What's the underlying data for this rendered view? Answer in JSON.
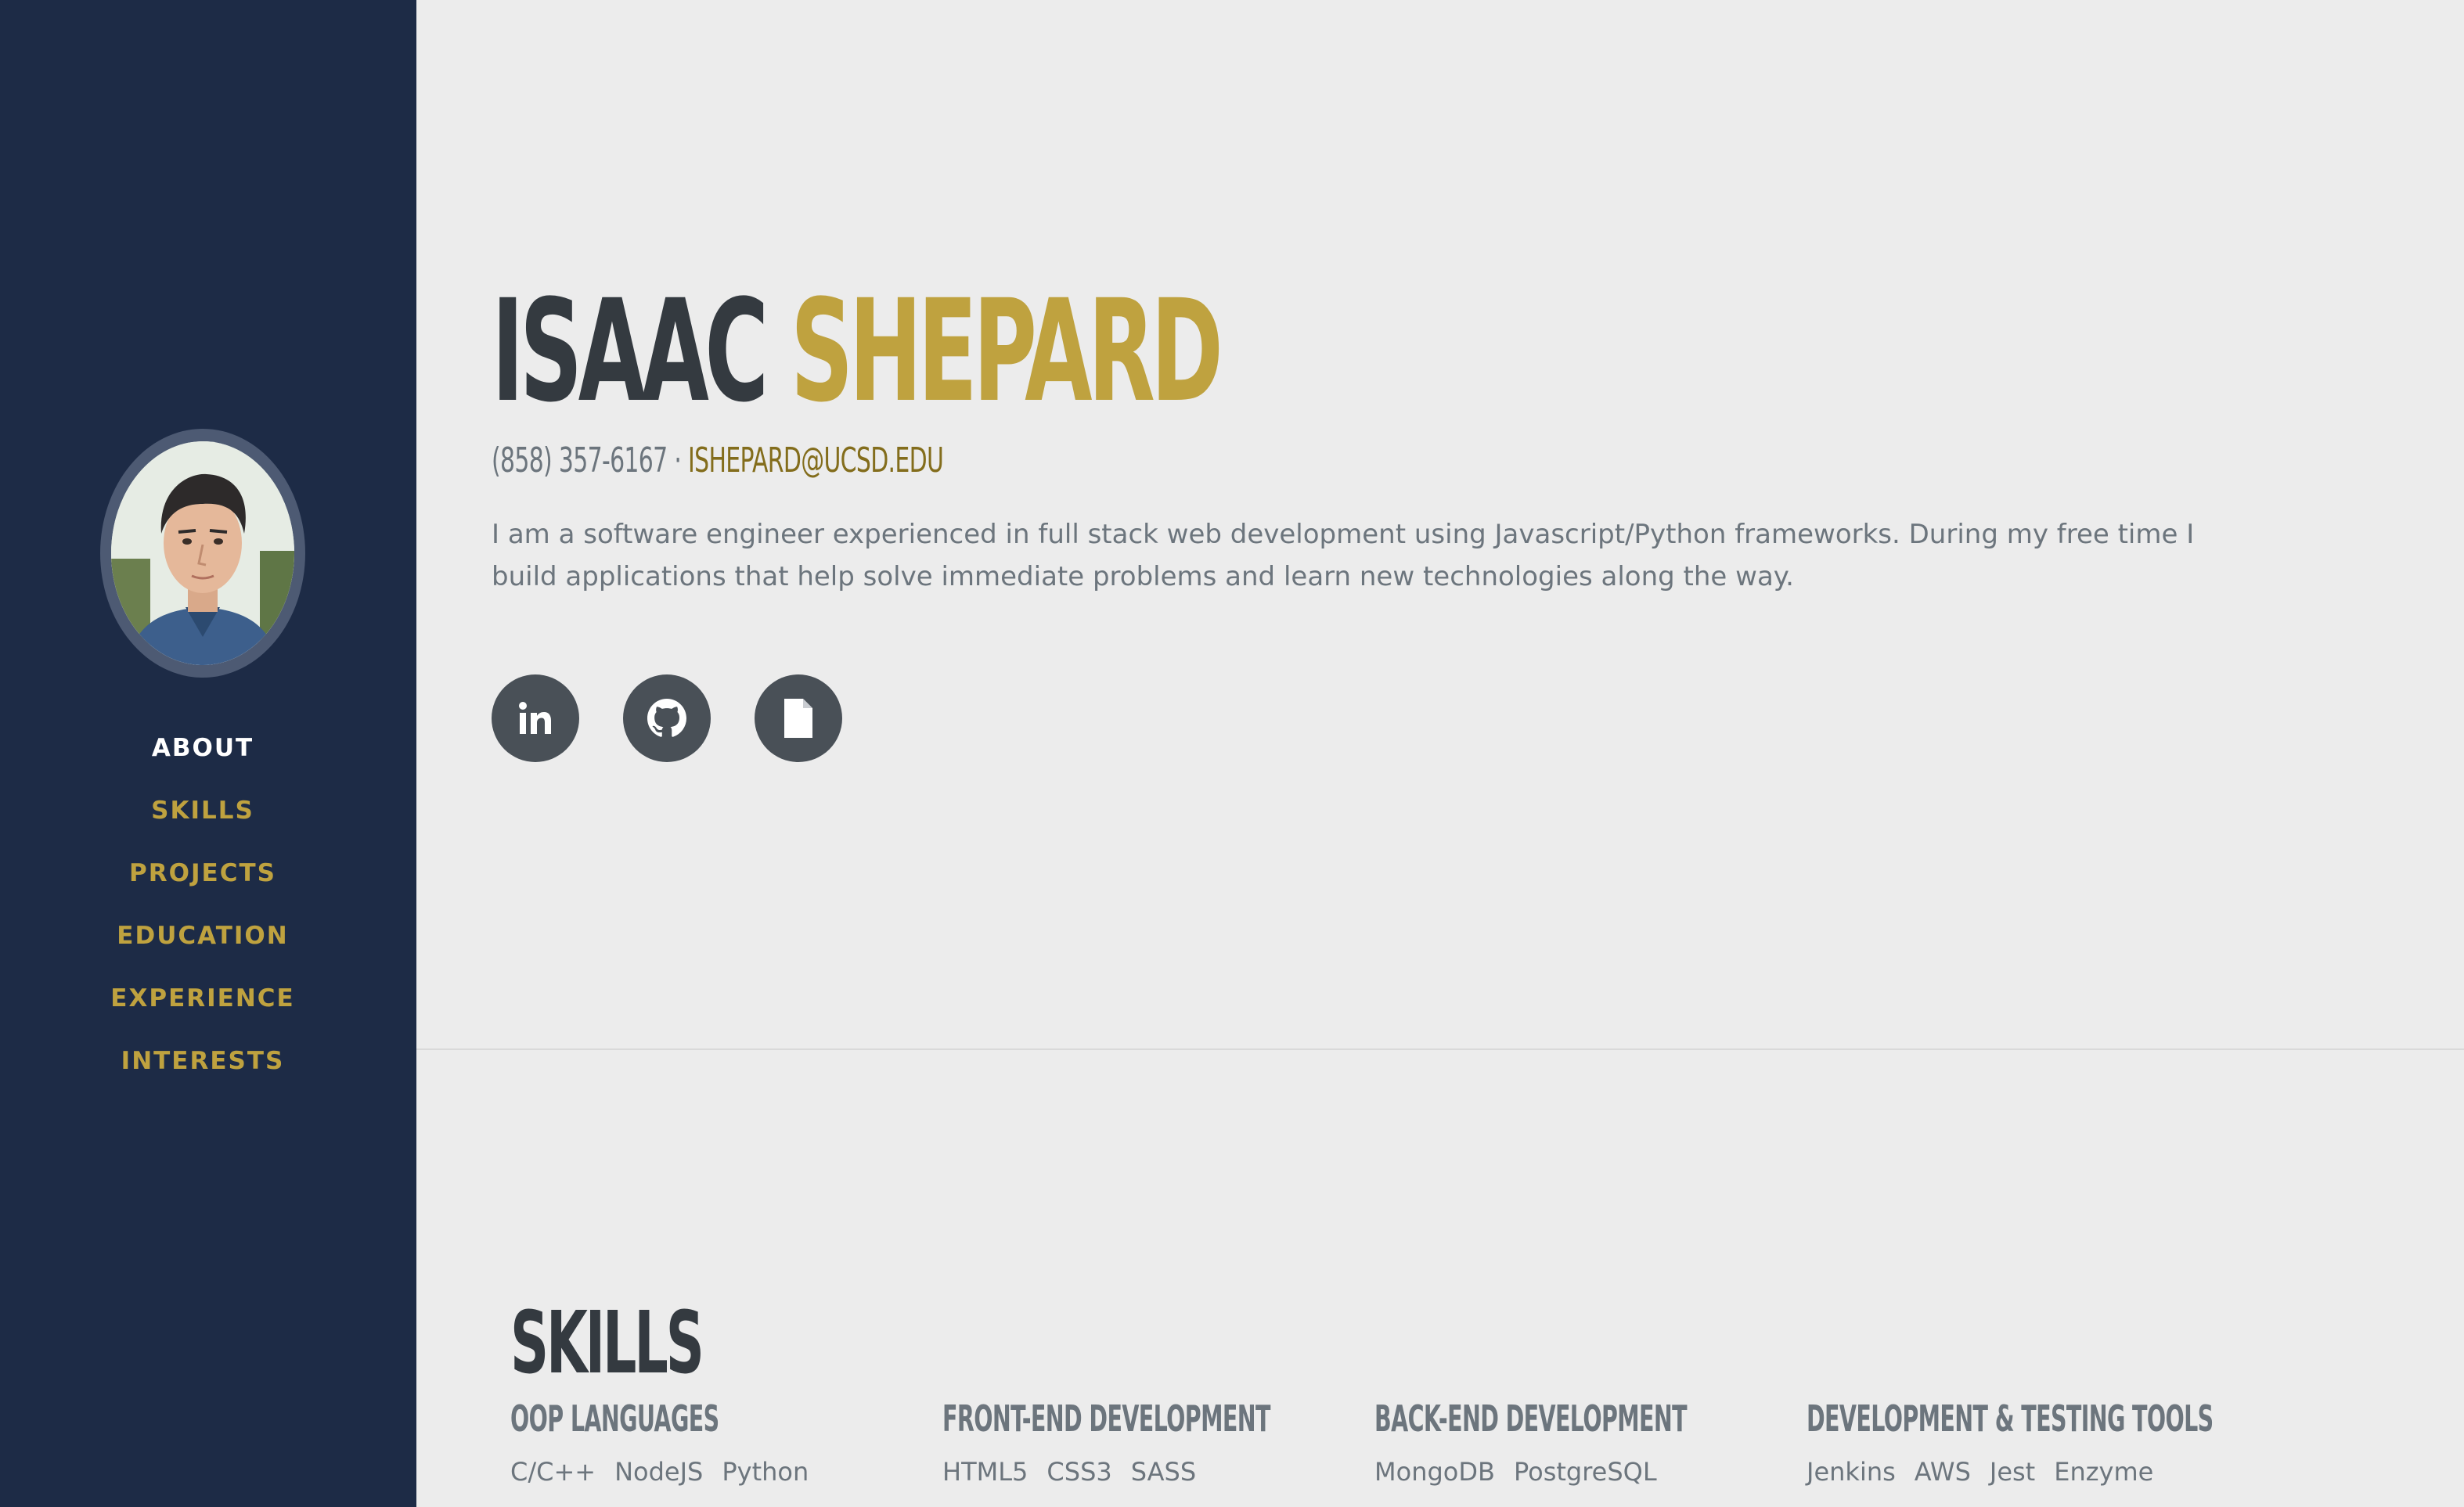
{
  "colors": {
    "sidebar_bg": "#1d2b46",
    "accent": "#bfa23f",
    "email": "#836d1c",
    "heading": "#343a40",
    "muted": "#6c757d",
    "page_bg": "#ececec"
  },
  "sidebar": {
    "nav": [
      {
        "label": "ABOUT",
        "active": true
      },
      {
        "label": "SKILLS",
        "active": false
      },
      {
        "label": "PROJECTS",
        "active": false
      },
      {
        "label": "EDUCATION",
        "active": false
      },
      {
        "label": "EXPERIENCE",
        "active": false
      },
      {
        "label": "INTERESTS",
        "active": false
      }
    ]
  },
  "about": {
    "first_name": "ISAAC",
    "last_name": "SHEPARD",
    "phone": "(858) 357-6167",
    "separator": "·",
    "email": "ISHEPARD@UCSD.EDU",
    "bio": "I am a software engineer experienced in full stack web development using Javascript/Python frameworks. During my free time I build applications that help solve immediate problems and learn new technologies along the way.",
    "socials": [
      {
        "icon": "linkedin-icon"
      },
      {
        "icon": "github-icon"
      },
      {
        "icon": "document-icon"
      }
    ]
  },
  "skills": {
    "title": "SKILLS",
    "columns": [
      {
        "title": "OOP LANGUAGES",
        "items": [
          "C/C++",
          "NodeJS",
          "Python"
        ]
      },
      {
        "title": "FRONT-END DEVELOPMENT",
        "items": [
          "HTML5",
          "CSS3",
          "SASS"
        ]
      },
      {
        "title": "BACK-END DEVELOPMENT",
        "items": [
          "MongoDB",
          "PostgreSQL"
        ]
      },
      {
        "title": "DEVELOPMENT & TESTING TOOLS",
        "items": [
          "Jenkins",
          "AWS",
          "Jest",
          "Enzyme"
        ]
      }
    ]
  }
}
